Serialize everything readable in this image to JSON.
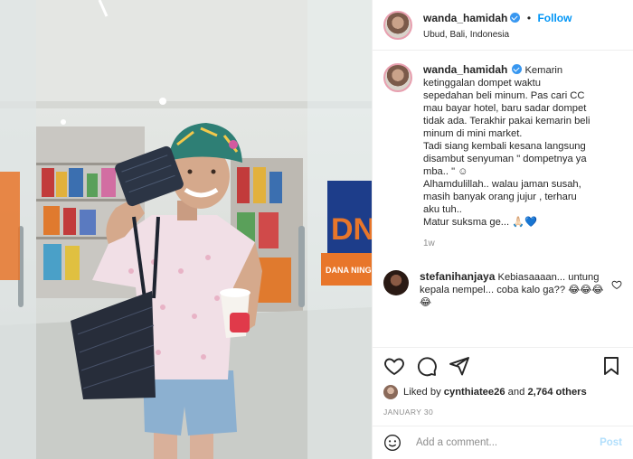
{
  "post": {
    "username": "wanda_hamidah",
    "follow_label": "Follow",
    "separator": "•",
    "location": "Ubud, Bali, Indonesia",
    "caption_lines": [
      "Kemarin",
      "ketinggalan dompet waktu",
      "sepedahan beli minum. Pas cari CC",
      "mau bayar hotel, baru sadar dompet",
      "tidak ada. Terakhir pakai kemarin beli",
      "minum di mini market.",
      "Tadi siang kembali kesana langsung",
      "disambut senyuman \" dompetnya ya",
      "mba.. \" ☺",
      "Alhamdulillah.. walau jaman susah,",
      "masih banyak orang jujur , terharu",
      "aku tuh..",
      "Matur suksma ge... 🙏🏻💙"
    ],
    "time_ago": "1w",
    "comments": [
      {
        "username": "stefanihanjaya",
        "text": "Kebiasaaaan... untung kepala nempel... coba kalo ga?? 😂😂😂😂"
      }
    ],
    "liked_by_prefix": "Liked by",
    "liked_by_user": "cynthiatee26",
    "liked_by_and": "and",
    "likes_count": "2,764 others",
    "date": "JANUARY 30",
    "add_comment_placeholder": "Add a comment...",
    "post_button": "Post"
  },
  "photo": {
    "store_sign_letters": "DN",
    "store_sign_sub": "DANA NING"
  },
  "icons": {
    "verified": "verified-badge-icon",
    "like": "heart-icon",
    "comment": "comment-icon",
    "share": "paper-plane-icon",
    "save": "bookmark-icon",
    "emoji": "smiley-icon"
  },
  "colors": {
    "accent": "#0095f6",
    "verified": "#3897f0",
    "muted": "#8e8e8e",
    "post_disabled": "#b2dffc",
    "border": "#efefef"
  }
}
